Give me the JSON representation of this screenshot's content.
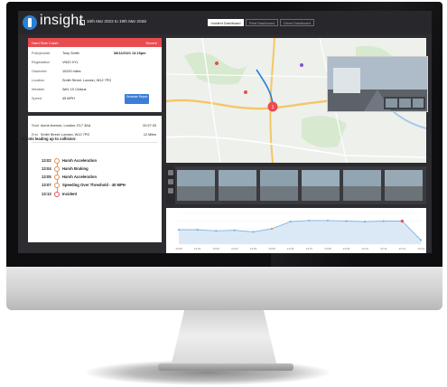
{
  "app": {
    "logo_text": "insight"
  },
  "header": {
    "date_range": "16th Mar 2022 to 19th Mar 2022",
    "date_arrows": "‹ ›",
    "tabs": [
      {
        "label": "Incident Dashboard",
        "active": true
      },
      {
        "label": "Fleet Dashboard",
        "active": false
      },
      {
        "label": "Driver Dashboard",
        "active": false
      }
    ]
  },
  "incident": {
    "title": "Hard Side Crash",
    "tag": "Severe",
    "date": "08/12/2021 13:15pm",
    "fields": [
      {
        "label": "Policyholder",
        "value": "Tony Smith"
      },
      {
        "label": "Registration",
        "value": "VN20 XYL"
      },
      {
        "label": "Odometer",
        "value": "10200 miles"
      },
      {
        "label": "Location",
        "value": "Smith Street, London, W12 7PG"
      },
      {
        "label": "Weather",
        "value": "Wet, 10 Celsius"
      },
      {
        "label": "Speed",
        "value": "45 MPH"
      }
    ],
    "report_button": "Generate Report"
  },
  "route": {
    "start": {
      "label": "Start",
      "address": "Acme Avenue, London, E17 3AA",
      "value": "00:27:33"
    },
    "end": {
      "label": "End",
      "address": "Smith Street, London, W12 7PG",
      "value": "12 Miles"
    }
  },
  "events": {
    "heading": "Events leading up to collision:",
    "items": [
      {
        "time": "13:02",
        "label": "Harsh Acceleration",
        "severity": "warning"
      },
      {
        "time": "13:04",
        "label": "Harsh Braking",
        "severity": "warning"
      },
      {
        "time": "13:05",
        "label": "Harsh Acceleration",
        "severity": "warning"
      },
      {
        "time": "13:07",
        "label": "Speeding Over Threshold - 40 MPH",
        "severity": "warning"
      },
      {
        "time": "13:13",
        "label": "Incident",
        "severity": "critical"
      }
    ]
  },
  "map": {
    "marker_label": "1"
  },
  "colors": {
    "accent_red": "#e84c51",
    "accent_blue": "#3b7dd8",
    "chart_line": "#7fb2e5",
    "event_orange": "#e0904e"
  },
  "chart_data": {
    "type": "area",
    "title": "",
    "xlabel": "",
    "ylabel": "",
    "x": [
      "13:00",
      "13:01",
      "13:02",
      "13:03",
      "13:04",
      "13:05",
      "13:06",
      "13:07",
      "13:08",
      "13:09",
      "13:10",
      "13:11",
      "13:12",
      "13:13"
    ],
    "series": [
      {
        "values": [
          28,
          28,
          26,
          27,
          24,
          30,
          44,
          46,
          46,
          45,
          44,
          45,
          45,
          8
        ]
      }
    ],
    "ylim": [
      0,
      60
    ],
    "grid": true
  }
}
